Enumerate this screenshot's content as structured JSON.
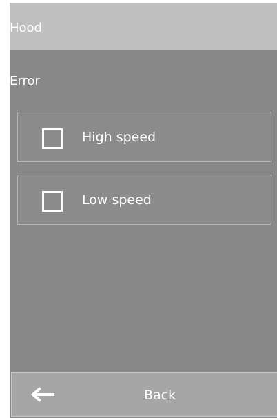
{
  "header": {
    "title": "Hood"
  },
  "section": {
    "label": "Error"
  },
  "options": [
    {
      "label": "High speed",
      "checked": false
    },
    {
      "label": "Low speed",
      "checked": false
    }
  ],
  "footer": {
    "back_label": "Back",
    "back_icon": "arrow-left-icon"
  },
  "colors": {
    "background": "#888888",
    "header": "#c0c0c0",
    "option_border": "#b5b5b5",
    "back_button": "#a6a6a6",
    "text": "#ffffff"
  }
}
